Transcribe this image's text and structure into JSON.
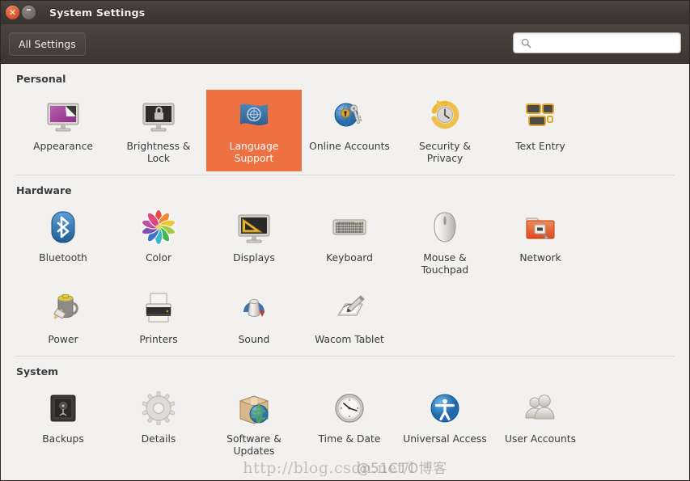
{
  "window": {
    "title": "System Settings",
    "close_label": "×",
    "minimize_label": "–"
  },
  "toolbar": {
    "all_settings_label": "All Settings",
    "search_placeholder": "",
    "search_value": "",
    "search_icon": "search-icon"
  },
  "colors": {
    "selection": "#ed7141",
    "titlebar": "#403a37",
    "content_bg": "#f2f1ef"
  },
  "sections": [
    {
      "title": "Personal",
      "items": [
        {
          "label": "Appearance",
          "icon": "appearance-icon",
          "selected": false
        },
        {
          "label": "Brightness & Lock",
          "icon": "brightness-lock-icon",
          "selected": false
        },
        {
          "label": "Language Support",
          "icon": "language-support-icon",
          "selected": true
        },
        {
          "label": "Online Accounts",
          "icon": "online-accounts-icon",
          "selected": false
        },
        {
          "label": "Security & Privacy",
          "icon": "security-privacy-icon",
          "selected": false
        },
        {
          "label": "Text Entry",
          "icon": "text-entry-icon",
          "selected": false
        }
      ]
    },
    {
      "title": "Hardware",
      "items": [
        {
          "label": "Bluetooth",
          "icon": "bluetooth-icon",
          "selected": false
        },
        {
          "label": "Color",
          "icon": "color-icon",
          "selected": false
        },
        {
          "label": "Displays",
          "icon": "displays-icon",
          "selected": false
        },
        {
          "label": "Keyboard",
          "icon": "keyboard-icon",
          "selected": false
        },
        {
          "label": "Mouse & Touchpad",
          "icon": "mouse-touchpad-icon",
          "selected": false
        },
        {
          "label": "Network",
          "icon": "network-icon",
          "selected": false
        },
        {
          "label": "Power",
          "icon": "power-icon",
          "selected": false
        },
        {
          "label": "Printers",
          "icon": "printers-icon",
          "selected": false
        },
        {
          "label": "Sound",
          "icon": "sound-icon",
          "selected": false
        },
        {
          "label": "Wacom Tablet",
          "icon": "wacom-tablet-icon",
          "selected": false
        }
      ]
    },
    {
      "title": "System",
      "items": [
        {
          "label": "Backups",
          "icon": "backups-icon",
          "selected": false
        },
        {
          "label": "Details",
          "icon": "details-icon",
          "selected": false
        },
        {
          "label": "Software & Updates",
          "icon": "software-updates-icon",
          "selected": false
        },
        {
          "label": "Time & Date",
          "icon": "time-date-icon",
          "selected": false
        },
        {
          "label": "Universal Access",
          "icon": "universal-access-icon",
          "selected": false
        },
        {
          "label": "User Accounts",
          "icon": "user-accounts-icon",
          "selected": false
        }
      ]
    }
  ],
  "watermark": {
    "text1": "http://blog.csdn.net/l",
    "text2": "@51CTO博客"
  }
}
